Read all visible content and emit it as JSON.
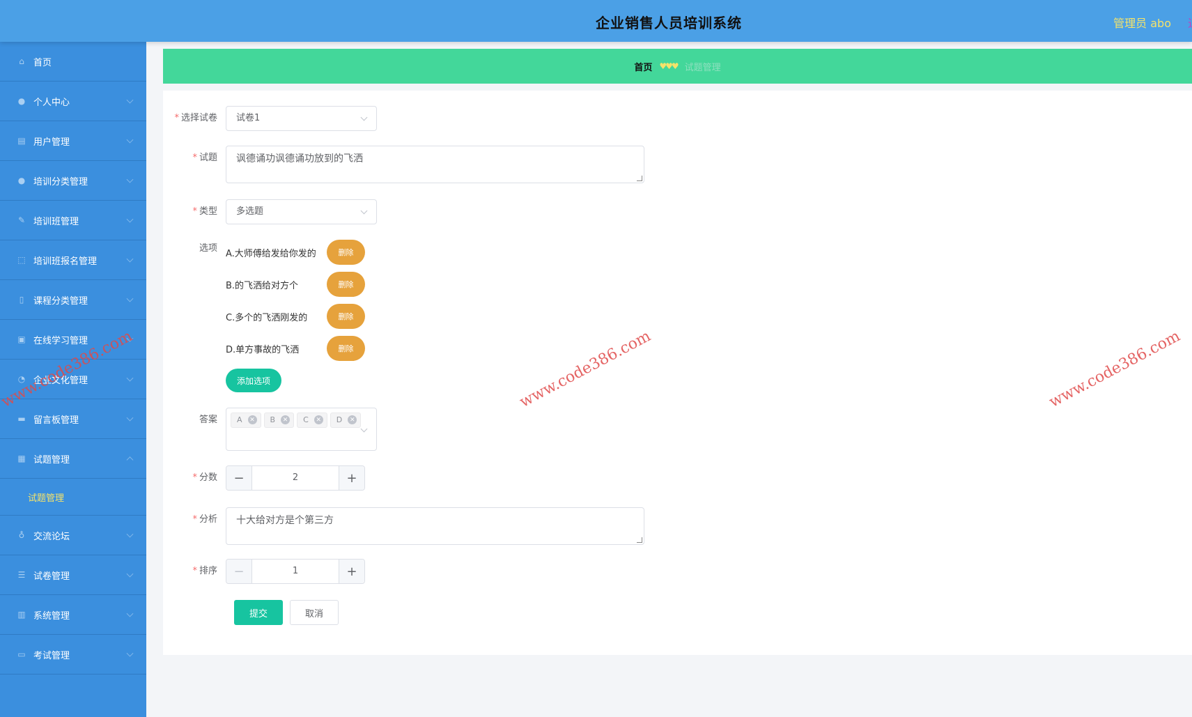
{
  "header": {
    "title": "企业销售人员培训系统",
    "user_label": "管理员 abo"
  },
  "sidebar": {
    "items": [
      {
        "label": "首页",
        "icon": "home-icon"
      },
      {
        "label": "个人中心",
        "icon": "user-icon"
      },
      {
        "label": "用户管理",
        "icon": "clipboard-icon"
      },
      {
        "label": "培训分类管理",
        "icon": "user-icon"
      },
      {
        "label": "培训班管理",
        "icon": "pen-icon"
      },
      {
        "label": "培训班报名管理",
        "icon": "frame-icon"
      },
      {
        "label": "课程分类管理",
        "icon": "mic-icon"
      },
      {
        "label": "在线学习管理",
        "icon": "lock-icon"
      },
      {
        "label": "企业文化管理",
        "icon": "chat-icon"
      },
      {
        "label": "留言板管理",
        "icon": "briefcase-icon"
      },
      {
        "label": "试题管理",
        "icon": "grid-icon"
      },
      {
        "label": "交流论坛",
        "icon": "mic-icon"
      },
      {
        "label": "试卷管理",
        "icon": "sliders-icon"
      },
      {
        "label": "系统管理",
        "icon": "books-icon"
      },
      {
        "label": "考试管理",
        "icon": "message-icon"
      }
    ],
    "submenu_active": "试题管理"
  },
  "breadcrumb": {
    "home": "首页",
    "separator": "♥♥♥",
    "current": "试题管理"
  },
  "form": {
    "paper": {
      "label": "选择试卷",
      "value": "试卷1"
    },
    "question": {
      "label": "试题",
      "value": "讽德诵功讽德诵功放到的飞洒"
    },
    "type": {
      "label": "类型",
      "value": "多选题"
    },
    "options": {
      "label": "选项",
      "items": [
        "A.大师傅给发给你发的",
        "B.的飞洒给对方个",
        "C.多个的飞洒刚发的",
        "D.单方事故的飞洒"
      ],
      "delete_label": "删除",
      "add_label": "添加选项"
    },
    "answer": {
      "label": "答案",
      "tags": [
        "A",
        "B",
        "C",
        "D"
      ],
      "remove_glyph": "✕"
    },
    "score": {
      "label": "分数",
      "value": "2"
    },
    "analysis": {
      "label": "分析",
      "value": "十大给对方是个第三方"
    },
    "order": {
      "label": "排序",
      "value": "1"
    },
    "submit_label": "提交",
    "cancel_label": "取消"
  },
  "watermark": "www.code386.com",
  "colors": {
    "header_bg": "#4ba0e6",
    "sidebar_bg": "#3b8fde",
    "breadcrumb_bg": "#43d79a",
    "accent_green": "#17c4a0",
    "delete_orange": "#e6a23c",
    "highlight_yellow": "#f5e36a"
  }
}
